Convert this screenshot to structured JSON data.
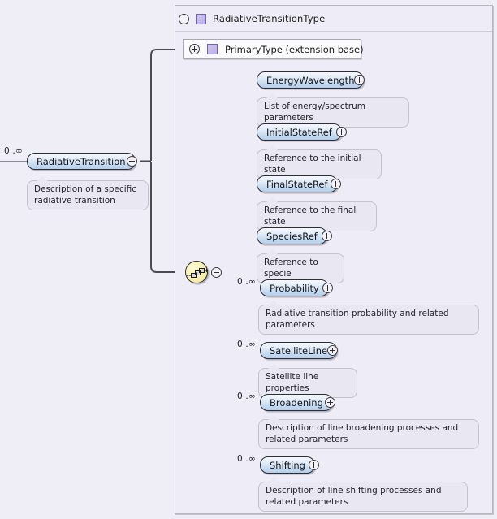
{
  "diagram": {
    "kind": "xml-schema-diagram",
    "root_element": {
      "name": "RadiativeTransition",
      "occurrence": "0..∞",
      "toggle": "minus",
      "annotation": "Description of a specific radiative transition"
    },
    "type_container": {
      "title": "RadiativeTransitionType",
      "toggle": "minus",
      "swatch_icon": "type-swatch-icon"
    },
    "extension_base": {
      "label": "PrimaryType (extension base)",
      "toggle": "plus",
      "swatch_icon": "type-swatch-icon"
    },
    "compositor": {
      "kind": "sequence",
      "icon": "sequence-icon",
      "toggle": "minus"
    },
    "children": [
      {
        "name": "EnergyWavelength",
        "occurrence": "",
        "toggle": "plus",
        "annotation": "List of energy/spectrum parameters"
      },
      {
        "name": "InitialStateRef",
        "occurrence": "",
        "toggle": "plus",
        "annotation": "Reference to the initial state"
      },
      {
        "name": "FinalStateRef",
        "occurrence": "",
        "toggle": "plus",
        "annotation": "Reference to the final state"
      },
      {
        "name": "SpeciesRef",
        "occurrence": "",
        "toggle": "plus",
        "annotation": "Reference to specie"
      },
      {
        "name": "Probability",
        "occurrence": "0..∞",
        "toggle": "plus",
        "annotation": "Radiative transition probability and related parameters"
      },
      {
        "name": "SatelliteLine",
        "occurrence": "0..∞",
        "toggle": "plus",
        "annotation": "Satellite line properties"
      },
      {
        "name": "Broadening",
        "occurrence": "0..∞",
        "toggle": "plus",
        "annotation": "Description of line broadening processes and related parameters"
      },
      {
        "name": "Shifting",
        "occurrence": "0..∞",
        "toggle": "plus",
        "annotation": "Description of line shifting processes and related parameters"
      }
    ],
    "colors": {
      "background": "#efedf5",
      "element_fill": "#c2d8f0",
      "element_border": "#2d2d35",
      "type_swatch": "#bcb0e6",
      "sequence_node": "#f7f0b2",
      "annotation_fill": "#e9e7f1",
      "connector": "#8f8d9c"
    }
  }
}
